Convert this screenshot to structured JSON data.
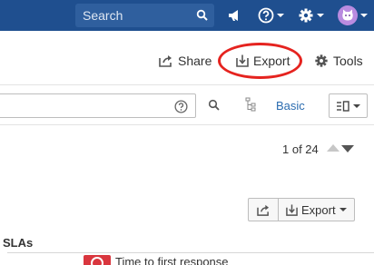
{
  "topbar": {
    "search_placeholder": "Search",
    "icons": [
      "search-icon",
      "megaphone-icon",
      "help-icon",
      "gear-icon",
      "avatar-cat-icon"
    ]
  },
  "actions": {
    "share_label": "Share",
    "export_label": "Export",
    "tools_label": "Tools",
    "highlight_color": "#e5231f"
  },
  "search_row": {
    "mode_label": "Basic"
  },
  "pager": {
    "text": "1 of 24"
  },
  "issue_toolbar": {
    "export_label": "Export"
  },
  "slas": {
    "title": "SLAs",
    "item_label": "Time to first response",
    "status_color": "#d9363e"
  },
  "colors": {
    "header_bg": "#1f4f8f",
    "link": "#2b6cb0"
  }
}
